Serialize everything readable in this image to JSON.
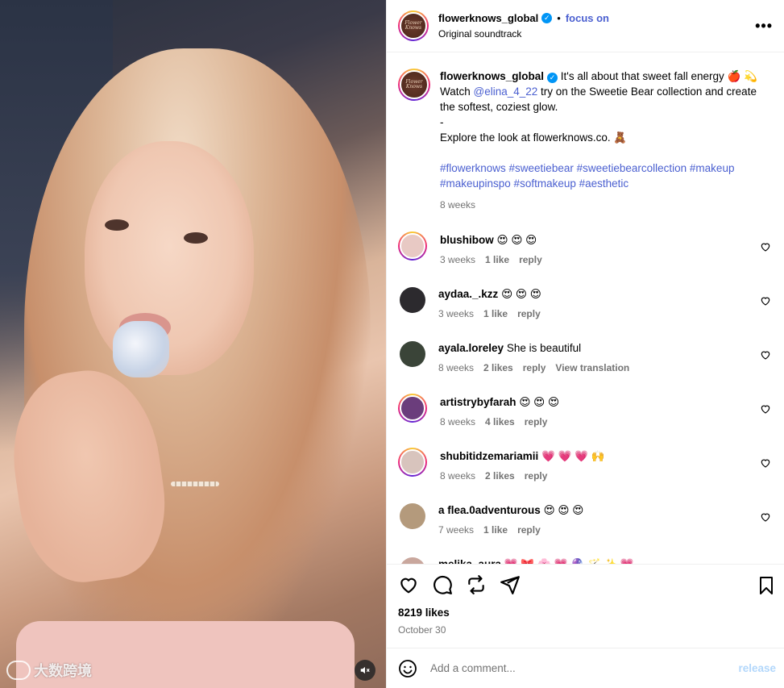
{
  "watermark": {
    "text": "大数跨境"
  },
  "header": {
    "username": "flowerknows_global",
    "dot": "•",
    "follow_label": "focus on",
    "audio": "Original soundtrack",
    "more_label": "•••",
    "avatar_text": "Flower Knows"
  },
  "caption": {
    "username": "flowerknows_global",
    "line1": " It's all about that sweet fall energy 🍎 💫",
    "watch": "Watch ",
    "mention": "@elina_4_22",
    "line2": " try on the Sweetie Bear collection and create the softest, coziest glow.",
    "dash": "-",
    "line3": "Explore the look at flowerknows.co. 🧸",
    "tags1": "#flowerknows #sweetiebear #sweetiebearcollection #makeup",
    "tags2": "#makeupinspo #softmakeup #aesthetic",
    "time": "8 weeks"
  },
  "comments": [
    {
      "user": "blushibow",
      "text": "😍 😍 😍",
      "time": "3 weeks",
      "likes": "1 like",
      "reply": "reply",
      "extra": "",
      "color": "#e8c9c4",
      "ring": true
    },
    {
      "user": "aydaa._.kzz",
      "text": "😍 😍 😍",
      "time": "3 weeks",
      "likes": "1 like",
      "reply": "reply",
      "extra": "",
      "color": "#2c2a2e",
      "ring": false
    },
    {
      "user": "ayala.loreley",
      "text": "She is beautiful",
      "time": "8 weeks",
      "likes": "2 likes",
      "reply": "reply",
      "extra": "View translation",
      "color": "#3a4438",
      "ring": false
    },
    {
      "user": "artistrybyfarah",
      "text": "😍 😍 😍",
      "time": "8 weeks",
      "likes": "4 likes",
      "reply": "reply",
      "extra": "",
      "color": "#6b3d7c",
      "ring": true
    },
    {
      "user": "shubitidzemariamii",
      "text": "💗 💗 💗 🙌",
      "time": "8 weeks",
      "likes": "2 likes",
      "reply": "reply",
      "extra": "",
      "color": "#d8c4bd",
      "ring": true
    },
    {
      "user": "a flea.0adventurous",
      "text": "😍 😍 😍",
      "time": "7 weeks",
      "likes": "1 like",
      "reply": "reply",
      "extra": "",
      "color": "#b49a7c",
      "ring": false
    },
    {
      "user": "melika_aura",
      "text": "💗 🎀 🌸 💗 🔮 🪄 ✨ 💗",
      "time": "",
      "likes": "",
      "reply": "",
      "extra": "",
      "color": "#c9a79d",
      "ring": false
    }
  ],
  "actions": {
    "likes": "8219 likes",
    "date": "October 30"
  },
  "add_comment": {
    "placeholder": "Add a comment...",
    "release_label": "release"
  }
}
